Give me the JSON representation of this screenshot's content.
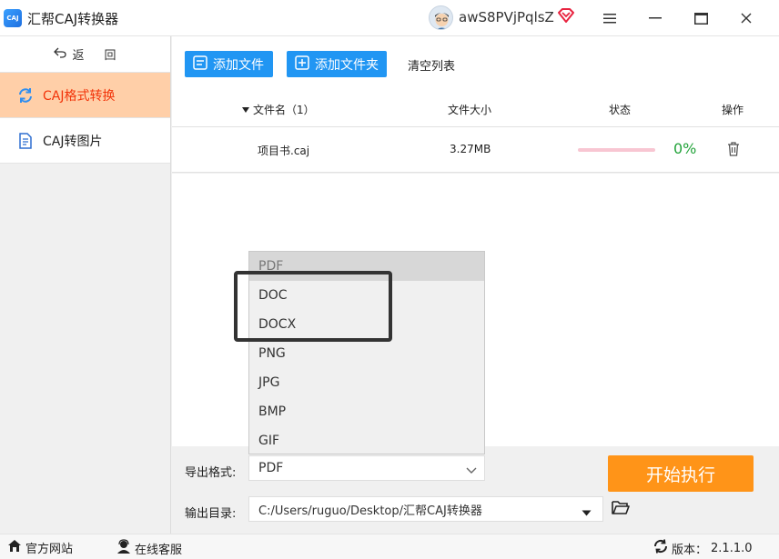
{
  "window": {
    "logo_text": "CAJ",
    "title": "汇帮CAJ转换器",
    "username": "awS8PVjPqlsZ",
    "icons": [
      "avatar",
      "vip-diamond-icon",
      "menu-icon",
      "minimize-icon",
      "maximize-icon",
      "close-icon"
    ]
  },
  "sidebar": {
    "back_label_1": "返",
    "back_label_2": "回",
    "items": [
      {
        "label": "CAJ格式转换",
        "icon": "refresh-icon",
        "active": true
      },
      {
        "label": "CAJ转图片",
        "icon": "document-icon",
        "active": false
      }
    ],
    "active_color": "#f2340a",
    "active_bg": "#ffcfa8"
  },
  "toolbar": {
    "add_file": "添加文件",
    "add_folder": "添加文件夹",
    "clear_list": "清空列表",
    "button_color": "#2196f3"
  },
  "table": {
    "headers": {
      "name": "文件名（1）",
      "size": "文件大小",
      "status": "状态",
      "action": "操作"
    },
    "rows": [
      {
        "name": "项目书.caj",
        "size": "3.27MB",
        "progress": "0%",
        "progress_value": 0
      }
    ]
  },
  "format_dropdown": {
    "options": [
      "PDF",
      "DOC",
      "DOCX",
      "PNG",
      "JPG",
      "BMP",
      "GIF"
    ],
    "selected": "PDF"
  },
  "settings": {
    "format_label": "导出格式:",
    "format_value": "PDF",
    "output_label": "输出目录:",
    "output_value": "C:/Users/ruguo/Desktop/汇帮CAJ转换器"
  },
  "start_button": {
    "label": "开始执行",
    "color": "#ff9418"
  },
  "footer": {
    "website": "官方网站",
    "support": "在线客服",
    "version_label": "版本：",
    "version": "2.1.1.0"
  }
}
